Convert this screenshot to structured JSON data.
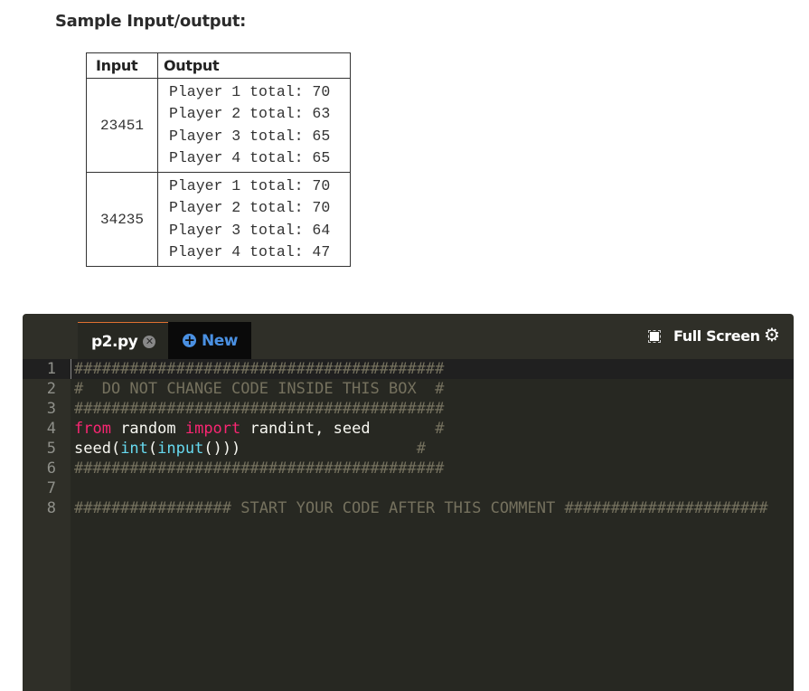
{
  "heading": "Sample Input/output:",
  "table": {
    "headers": [
      "Input",
      "Output"
    ],
    "rows": [
      {
        "input": "23451",
        "output": [
          "Player 1 total: 70",
          "Player 2 total: 63",
          "Player 3 total: 65",
          "Player 4 total: 65"
        ]
      },
      {
        "input": "34235",
        "output": [
          "Player 1 total: 70",
          "Player 2 total: 70",
          "Player 3 total: 64",
          "Player 4 total: 47"
        ]
      }
    ]
  },
  "editor": {
    "tabs": [
      {
        "label": "p2.py",
        "active": true
      }
    ],
    "new_label": "New",
    "fullscreen_label": "Full Screen",
    "line_numbers": [
      "1",
      "2",
      "3",
      "4",
      "5",
      "6",
      "7",
      "8"
    ],
    "code": {
      "l1": "########################################",
      "l2": "#  DO NOT CHANGE CODE INSIDE THIS BOX  #",
      "l3": "########################################",
      "l4_kw1": "from",
      "l4_a": " random ",
      "l4_kw2": "import",
      "l4_b": " randint, seed",
      "l4_c": "       #",
      "l5_a": "seed(",
      "l5_b1": "int",
      "l5_p": "(",
      "l5_b2": "input",
      "l5_c": "()))",
      "l5_d": "                   #",
      "l6": "########################################",
      "l8": "################# START YOUR CODE AFTER THIS COMMENT ######################"
    },
    "colors": {
      "background": "#272822",
      "keyword": "#f92672",
      "builtin": "#66d9ef",
      "comment": "#75715e",
      "new_tab": "#4a90e2"
    }
  }
}
